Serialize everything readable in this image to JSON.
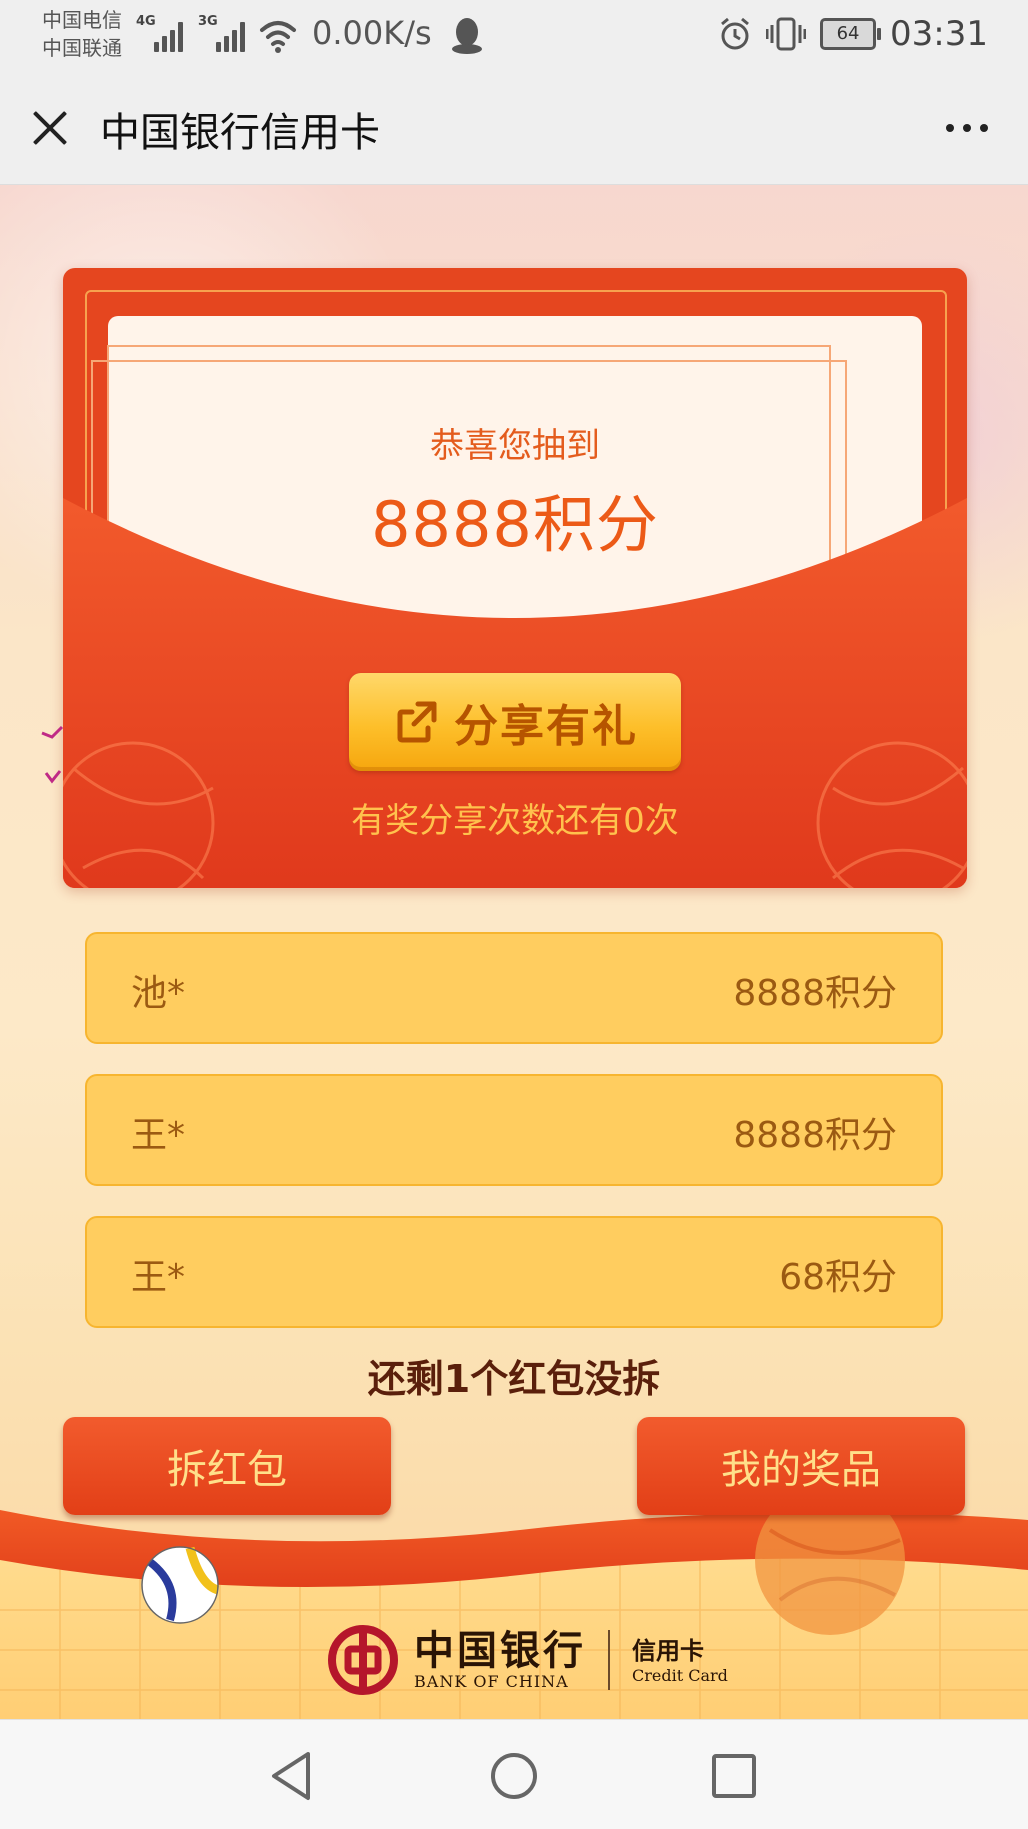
{
  "status_bar": {
    "carrier_1": "中国电信",
    "carrier_2": "中国联通",
    "signal_1_tag": "4G",
    "signal_2_tag": "3G",
    "net_speed": "0.00K/s",
    "battery": "64",
    "time": "03:31"
  },
  "title_bar": {
    "title": "中国银行信用卡"
  },
  "envelope": {
    "congrats": "恭喜您抽到",
    "prize": "8888积分",
    "share_button": "分享有礼",
    "share_hint": "有奖分享次数还有0次"
  },
  "winners": [
    {
      "name": "池*",
      "points": "8888积分"
    },
    {
      "name": "王*",
      "points": "8888积分"
    },
    {
      "name": "王*",
      "points": "68积分"
    }
  ],
  "remaining_text": "还剩1个红包没拆",
  "buttons": {
    "open": "拆红包",
    "my_prizes": "我的奖品"
  },
  "footer": {
    "bank_cn": "中国银行",
    "bank_en": "BANK OF CHINA",
    "card_cn": "信用卡",
    "card_en": "Credit Card"
  },
  "icons": {
    "close": "close-icon",
    "more": "more-icon",
    "share": "share-icon",
    "back": "back-icon",
    "home": "home-icon",
    "recents": "recents-icon"
  },
  "colors": {
    "envelope_red": "#e5461f",
    "gold_button": "#fdbf2a",
    "row_yellow": "#ffcd5f",
    "action_red": "#e23f17"
  }
}
